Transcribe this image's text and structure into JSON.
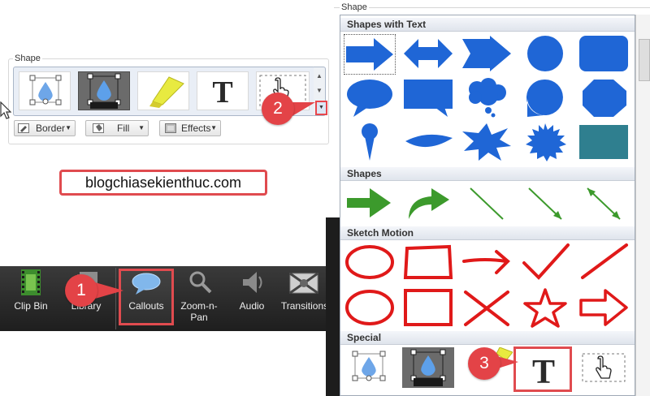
{
  "left_panel": {
    "group_title": "Shape",
    "gallery_items": [
      "callout-thumb",
      "callout-thumb-dark",
      "highlight-thumb",
      "text-thumb",
      "cursor-thumb"
    ],
    "border_label": "Border",
    "fill_label": "Fill",
    "effects_label": "Effects"
  },
  "annotations": {
    "badge1": "1",
    "badge2": "2",
    "badge3": "3",
    "website": "blogchiasekienthuc.com"
  },
  "toolbar": {
    "items": [
      {
        "label": "Clip Bin",
        "icon": "film-icon"
      },
      {
        "label": "Library",
        "icon": "library-icon"
      },
      {
        "label": "Callouts",
        "icon": "speech-bubble-icon"
      },
      {
        "label": "Zoom-n-\nPan",
        "icon": "magnifier-icon"
      },
      {
        "label": "Audio",
        "icon": "speaker-icon"
      },
      {
        "label": "Transitions",
        "icon": "transitions-icon"
      }
    ]
  },
  "dropdown": {
    "group_title": "Shape",
    "sections": {
      "shapes_with_text": "Shapes with Text",
      "shapes": "Shapes",
      "sketch_motion": "Sketch Motion",
      "special": "Special"
    }
  },
  "colors": {
    "blue": "#1f66d6",
    "green": "#3c9a2c",
    "red": "#e01919",
    "teal": "#2f7f8f",
    "highlight_red": "#e04b4f"
  }
}
